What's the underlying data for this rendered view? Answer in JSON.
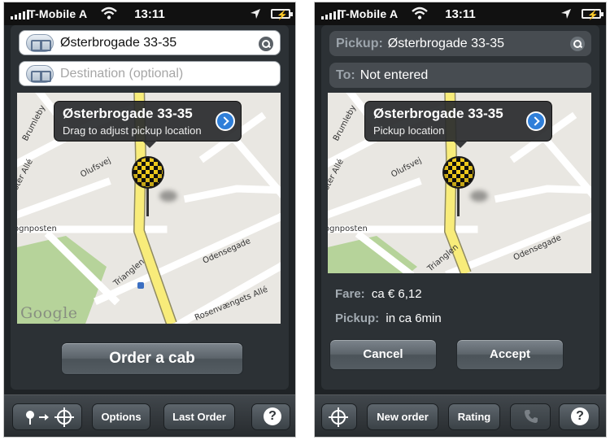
{
  "status_bar": {
    "carrier": "T-Mobile A",
    "time": "13:11"
  },
  "left": {
    "pickup_value": "Østerbrogade 33-35",
    "destination_placeholder": "Destination (optional)",
    "callout_title": "Østerbrogade 33-35",
    "callout_subtitle": "Drag to adjust pickup location",
    "order_button": "Order a cab",
    "toolbar": {
      "options": "Options",
      "last_order": "Last Order",
      "help": "?"
    }
  },
  "right": {
    "pickup_label": "Pickup:",
    "pickup_value": "Østerbrogade 33-35",
    "to_label": "To:",
    "to_value": "Not entered",
    "callout_title": "Østerbrogade 33-35",
    "callout_subtitle": "Pickup location",
    "fare_label": "Fare:",
    "fare_value": "ca € 6,12",
    "pickup_time_label": "Pickup:",
    "pickup_time_value": "in ca 6min",
    "cancel_button": "Cancel",
    "accept_button": "Accept",
    "toolbar": {
      "new_order": "New order",
      "rating": "Rating",
      "help": "?"
    }
  },
  "map": {
    "streets": [
      "Østerbrogade",
      "Brumleby",
      "Olufsvej",
      "ster Allé",
      "ognposten",
      "Odensegade",
      "Trianglen",
      "Rosenvængets Allé"
    ],
    "attribution": "Google"
  },
  "colors": {
    "accent": "#2f7fd9",
    "road_major": "#f8ec7a",
    "park": "#b6d39a"
  },
  "icons": [
    "signal-icon",
    "wifi-icon",
    "location-arrow-icon",
    "battery-icon",
    "address-book-icon",
    "search-icon",
    "disclosure-icon",
    "taxi-pin-icon",
    "crosshair-icon",
    "phone-icon",
    "help-icon"
  ]
}
